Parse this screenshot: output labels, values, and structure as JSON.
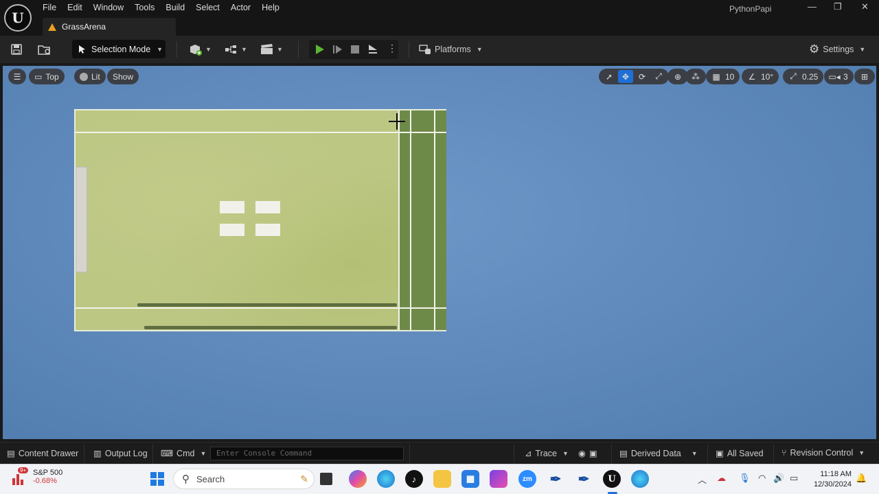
{
  "menu": [
    "File",
    "Edit",
    "Window",
    "Tools",
    "Build",
    "Select",
    "Actor",
    "Help"
  ],
  "project_tab": "GrassArena",
  "project_name": "PythonPapi",
  "toolbar": {
    "selection_mode": "Selection Mode",
    "platforms": "Platforms",
    "settings": "Settings"
  },
  "viewport": {
    "view_mode": "Top",
    "lit_mode": "Lit",
    "show": "Show",
    "grid_snap": "10",
    "rotation_snap": "10°",
    "scale_snap": "0.25",
    "camera_speed": "3"
  },
  "statusbar": {
    "content_drawer": "Content Drawer",
    "output_log": "Output Log",
    "cmd": "Cmd",
    "console_placeholder": "Enter Console Command",
    "trace": "Trace",
    "derived_data": "Derived Data",
    "all_saved": "All Saved",
    "revision_control": "Revision Control"
  },
  "taskbar": {
    "stock_name": "S&P 500",
    "stock_change": "-0.68%",
    "stock_badge": "9+",
    "search_placeholder": "Search",
    "time": "11:18 AM",
    "date": "12/30/2024"
  },
  "colors": {
    "viewport_bg": "#6a94c4",
    "grass_light": "#bcc784",
    "grass_dark": "#6e8a49",
    "accent": "#1f6fd6",
    "play_green": "#5bb632"
  }
}
